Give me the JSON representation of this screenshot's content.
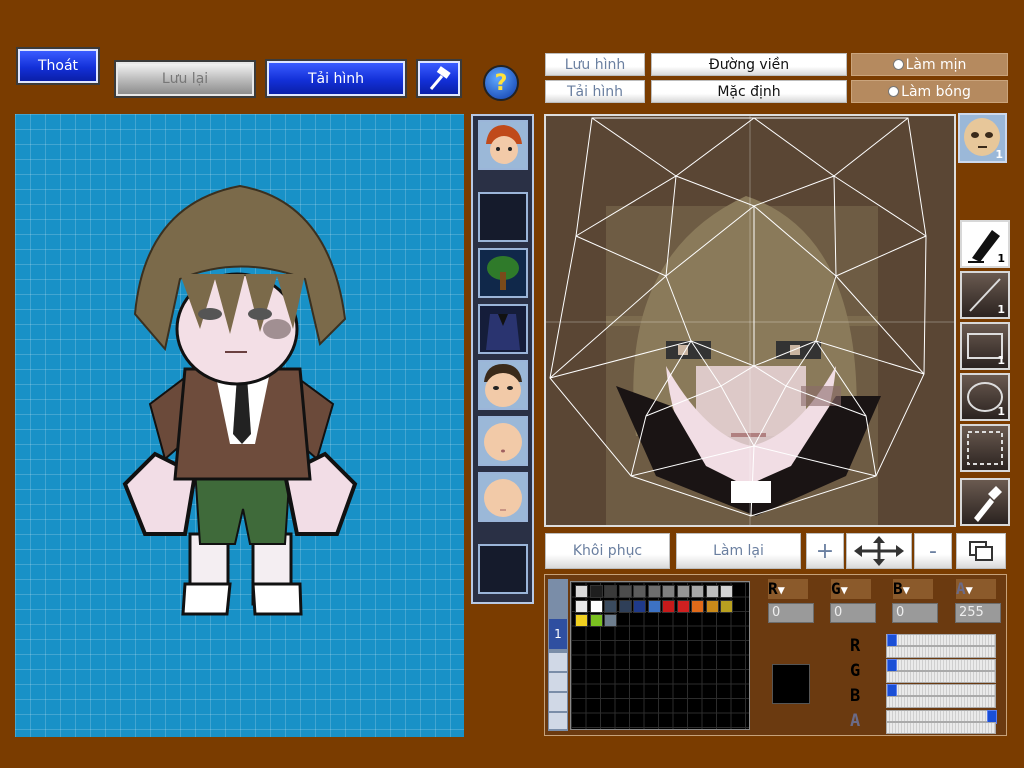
{
  "top_buttons": {
    "exit": "Thoát",
    "save": "Lưu lại",
    "load_image": "Tải hình",
    "help": "?"
  },
  "editor_top": {
    "save_image": "Lưu hình",
    "load_image": "Tải hình",
    "outline": "Đường viền",
    "default": "Mặc định",
    "smooth": "Làm mịn",
    "shade": "Làm bóng"
  },
  "tool_counts": {
    "face_preview": "1",
    "pen": "1",
    "line": "1",
    "rect": "1",
    "ellipse": "1"
  },
  "bottom_buttons": {
    "restore": "Khôi phục",
    "redo": "Làm lại",
    "plus": "+",
    "minus": "-"
  },
  "palette_tab": "1",
  "channels": {
    "r_label": "R",
    "g_label": "G",
    "b_label": "B",
    "a_label": "A",
    "r": "0",
    "g": "0",
    "b": "0",
    "a": "255"
  },
  "current_color": "#000000",
  "slider_levels": {
    "r": 0,
    "g": 0,
    "b": 0,
    "a": 1.0
  },
  "palette_colors": [
    "#d9d9d9",
    "#1e1e1e",
    "#3a3a3a",
    "#4d4d4d",
    "#5c5c5c",
    "#6e6e6e",
    "#808080",
    "#959595",
    "#a8a8a8",
    "#bdbdbd",
    "#d2d2d2",
    "#e8e8e8",
    "#ffffff",
    "#3b4b5e",
    "#2f3f58",
    "#1f3a8a",
    "#3d72c4",
    "#c61a1a",
    "#d02020",
    "#e06a1a",
    "#c98a1a",
    "#b8a020",
    "#f0d020",
    "#7ac020",
    "#6e7e8e"
  ]
}
